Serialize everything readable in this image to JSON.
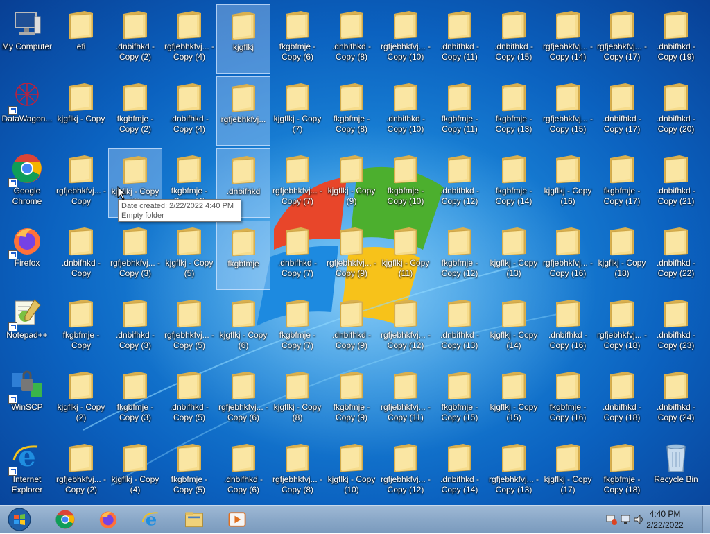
{
  "desktop": {
    "system_icons": [
      {
        "label": "My Computer",
        "icon": "computer-icon",
        "shortcut": false
      },
      {
        "label": "DataWagon...",
        "icon": "datawagon-icon",
        "shortcut": true
      },
      {
        "label": "Google Chrome",
        "icon": "chrome-icon",
        "shortcut": true
      },
      {
        "label": "Firefox",
        "icon": "firefox-icon",
        "shortcut": true
      },
      {
        "label": "Notepad++",
        "icon": "notepadpp-icon",
        "shortcut": true
      },
      {
        "label": "WinSCP",
        "icon": "winscp-icon",
        "shortcut": true
      },
      {
        "label": "Internet Explorer",
        "icon": "ie-icon",
        "shortcut": true
      }
    ],
    "folder_columns": [
      [
        "efi",
        "kjgflkj - Copy",
        "rgfjebhkfvj... - Copy",
        ".dnbifhkd - Copy",
        "fkgbfmje - Copy",
        "kjgflkj - Copy (2)",
        "rgfjebhkfvj... - Copy (2)"
      ],
      [
        ".dnbifhkd - Copy (2)",
        "fkgbfmje - Copy (2)",
        "kjgflkj - Copy (2)",
        "rgfjebhkfvj... - Copy (3)",
        ".dnbifhkd - Copy (3)",
        "fkgbfmje - Copy (3)",
        "kjgflkj - Copy (4)"
      ],
      [
        "rgfjebhkfvj... - Copy (4)",
        ".dnbifhkd - Copy (4)",
        "fkgbfmje - Copy (4)",
        "kjgflkj - Copy (5)",
        "rgfjebhkfvj... - Copy (5)",
        ".dnbifhkd - Copy (5)",
        "fkgbfmje - Copy (5)"
      ],
      [
        "kjgflkj",
        "rgfjebhkfvj...",
        ".dnbifhkd",
        "fkgbfmje",
        "kjgflkj - Copy (6)",
        "rgfjebhkfvj... - Copy (6)",
        ".dnbifhkd - Copy (6)"
      ],
      [
        "fkgbfmje - Copy (6)",
        "kjgflkj - Copy (7)",
        "rgfjebhkfvj... - Copy (7)",
        ".dnbifhkd - Copy (7)",
        "fkgbfmje - Copy (7)",
        "kjgflkj - Copy (8)",
        "rgfjebhkfvj... - Copy (8)"
      ],
      [
        ".dnbifhkd - Copy (8)",
        "fkgbfmje - Copy (8)",
        "kjgflkj - Copy (9)",
        "rgfjebhkfvj... - Copy (9)",
        ".dnbifhkd - Copy (9)",
        "fkgbfmje - Copy (9)",
        "kjgflkj - Copy (10)"
      ],
      [
        "rgfjebhkfvj... - Copy (10)",
        ".dnbifhkd - Copy (10)",
        "fkgbfmje - Copy (10)",
        "kjgflkj - Copy (11)",
        "rgfjebhkfvj... - Copy (12)",
        "rgfjebhkfvj... - Copy (11)",
        "rgfjebhkfvj... - Copy (12)"
      ],
      [
        ".dnbifhkd - Copy (11)",
        "fkgbfmje - Copy (11)",
        ".dnbifhkd - Copy (12)",
        "fkgbfmje - Copy (12)",
        ".dnbifhkd - Copy (13)",
        "fkgbfmje - Copy (15)",
        ".dnbifhkd - Copy (14)"
      ],
      [
        ".dnbifhkd - Copy (15)",
        "fkgbfmje - Copy (13)",
        "fkgbfmje - Copy (14)",
        "kjgflkj - Copy (13)",
        "kjgflkj - Copy (14)",
        "kjgflkj - Copy (15)",
        "rgfjebhkfvj... - Copy (13)"
      ],
      [
        "rgfjebhkfvj... - Copy (14)",
        "rgfjebhkfvj... - Copy (15)",
        "kjgflkj - Copy (16)",
        "rgfjebhkfvj... - Copy (16)",
        ".dnbifhkd - Copy (16)",
        "fkgbfmje - Copy (16)",
        "kjgflkj - Copy (17)"
      ],
      [
        "rgfjebhkfvj... - Copy (17)",
        ".dnbifhkd - Copy (17)",
        "fkgbfmje - Copy (17)",
        "kjgflkj - Copy (18)",
        "rgfjebhkfvj... - Copy (18)",
        ".dnbifhkd - Copy (18)",
        "fkgbfmje - Copy (18)"
      ],
      [
        ".dnbifhkd - Copy (19)",
        ".dnbifhkd - Copy (20)",
        ".dnbifhkd - Copy (21)",
        ".dnbifhkd - Copy (22)",
        ".dnbifhkd - Copy (23)",
        ".dnbifhkd - Copy (24)",
        "Recycle Bin"
      ]
    ],
    "selected": [
      "kjgflkj",
      "rgfjebhkfvj...",
      "kjgflkj - Copy (2)",
      ".dnbifhkd",
      "fkgbfmje"
    ],
    "tooltip": {
      "line1": "Date created: 2/22/2022 4:40 PM",
      "line2": "Empty folder"
    }
  },
  "taskbar": {
    "pinned": [
      {
        "name": "chrome-taskbar-button",
        "icon": "chrome-icon"
      },
      {
        "name": "firefox-taskbar-button",
        "icon": "firefox-icon"
      },
      {
        "name": "ie-taskbar-button",
        "icon": "ie-icon"
      },
      {
        "name": "explorer-taskbar-button",
        "icon": "folder-icon"
      },
      {
        "name": "media-player-taskbar-button",
        "icon": "media-player-icon"
      }
    ],
    "clock": {
      "time": "4:40 PM",
      "date": "2/22/2022"
    }
  },
  "colors": {
    "folder": "#f1d27a",
    "folder_dark": "#d9b04f",
    "taskbar": "#8aa8c8",
    "desktop": "#1a84d8"
  }
}
